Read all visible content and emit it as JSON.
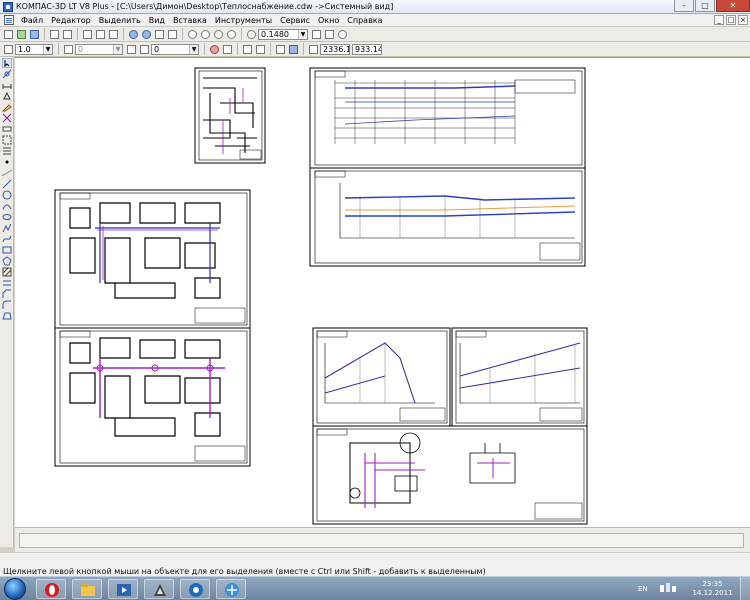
{
  "window": {
    "title": "КОМПАС-3D LT V8 Plus - [C:\\Users\\Димон\\Desktop\\Теплоснабжение.cdw ->Системный вид]",
    "minimize_label": "–",
    "maximize_label": "□",
    "close_label": "✕"
  },
  "menu": {
    "items": [
      "Файл",
      "Редактор",
      "Выделить",
      "Вид",
      "Вставка",
      "Инструменты",
      "Сервис",
      "Окно",
      "Справка"
    ],
    "mdi_minimize": "_",
    "mdi_restore": "□",
    "mdi_close": "×"
  },
  "toolbar1": {
    "zoom_value": "0.1480"
  },
  "toolbar2": {
    "line_scale": "1.0",
    "layer_value": "0",
    "view_value": "0",
    "coord_x": "2336.1",
    "coord_y": "933.14"
  },
  "status": {
    "hint": "Щелкните левой кнопкой мыши на объекте для его выделения (вместе с Ctrl или Shift - добавить к выделенным)"
  },
  "taskbar": {
    "language": "EN",
    "time": "23:35",
    "date": "14.12.2011",
    "apps": [
      "opera-icon",
      "explorer-folder-icon",
      "media-icon",
      "kompas-icon",
      "app-icon",
      "browser-icon"
    ]
  },
  "colors": {
    "accent": "#2f66c7",
    "drawing_blue": "#3030b0",
    "drawing_magenta": "#a020c0",
    "drawing_orange": "#e0a040"
  }
}
